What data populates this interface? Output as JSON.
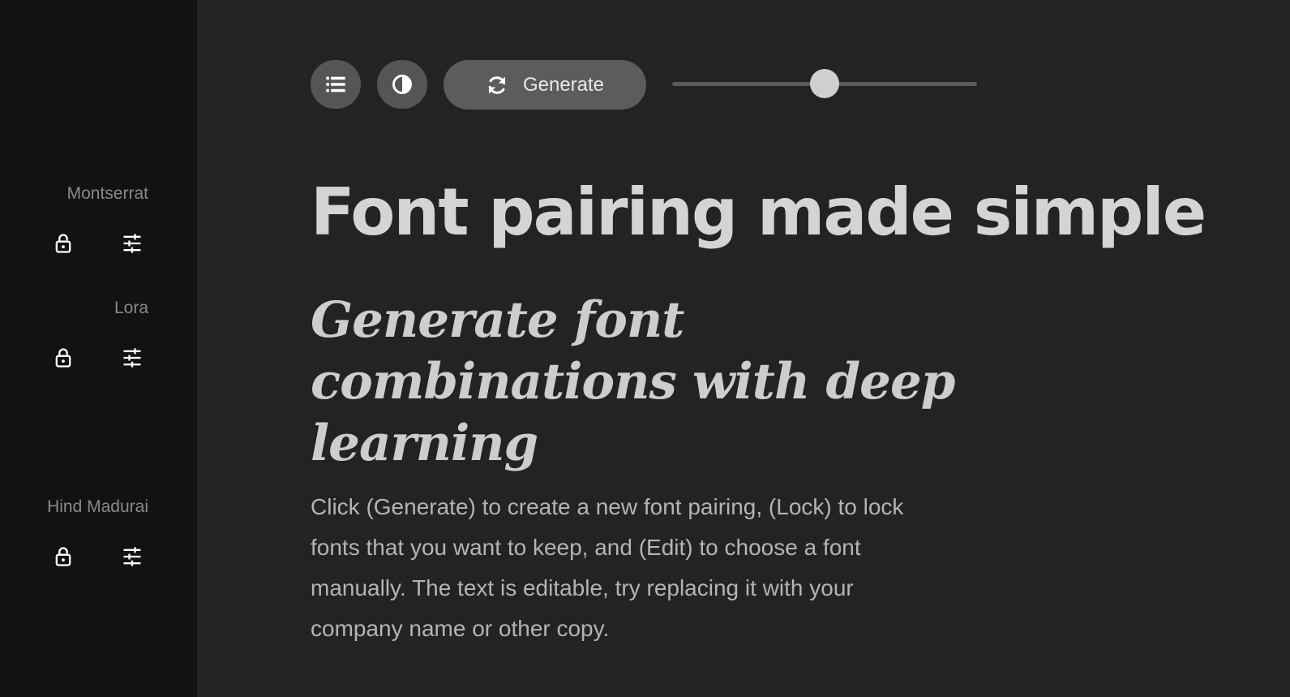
{
  "sidebar": {
    "fonts": [
      {
        "name": "Montserrat",
        "lock_icon": "unlock-icon",
        "edit_icon": "sliders-icon"
      },
      {
        "name": "Lora",
        "lock_icon": "unlock-icon",
        "edit_icon": "sliders-icon"
      },
      {
        "name": "Hind Madurai",
        "lock_icon": "unlock-icon",
        "edit_icon": "sliders-icon"
      }
    ]
  },
  "toolbar": {
    "list_icon": "list-icon",
    "contrast_icon": "contrast-icon",
    "generate_icon": "refresh-icon",
    "generate_label": "Generate",
    "slider_value_fraction": 0.5
  },
  "content": {
    "headline": "Font pairing made simple",
    "subheading": "Generate font combinations with deep learning",
    "body": "Click (Generate) to create a new font pairing, (Lock) to lock fonts that you want to keep, and (Edit) to choose a font manually. The text is editable, try replacing it with your company name or other copy."
  },
  "colors": {
    "page_background": "#232323",
    "sidebar_background": "#121212",
    "button_background": "#555555",
    "headline_text": "#d4d4d4"
  }
}
